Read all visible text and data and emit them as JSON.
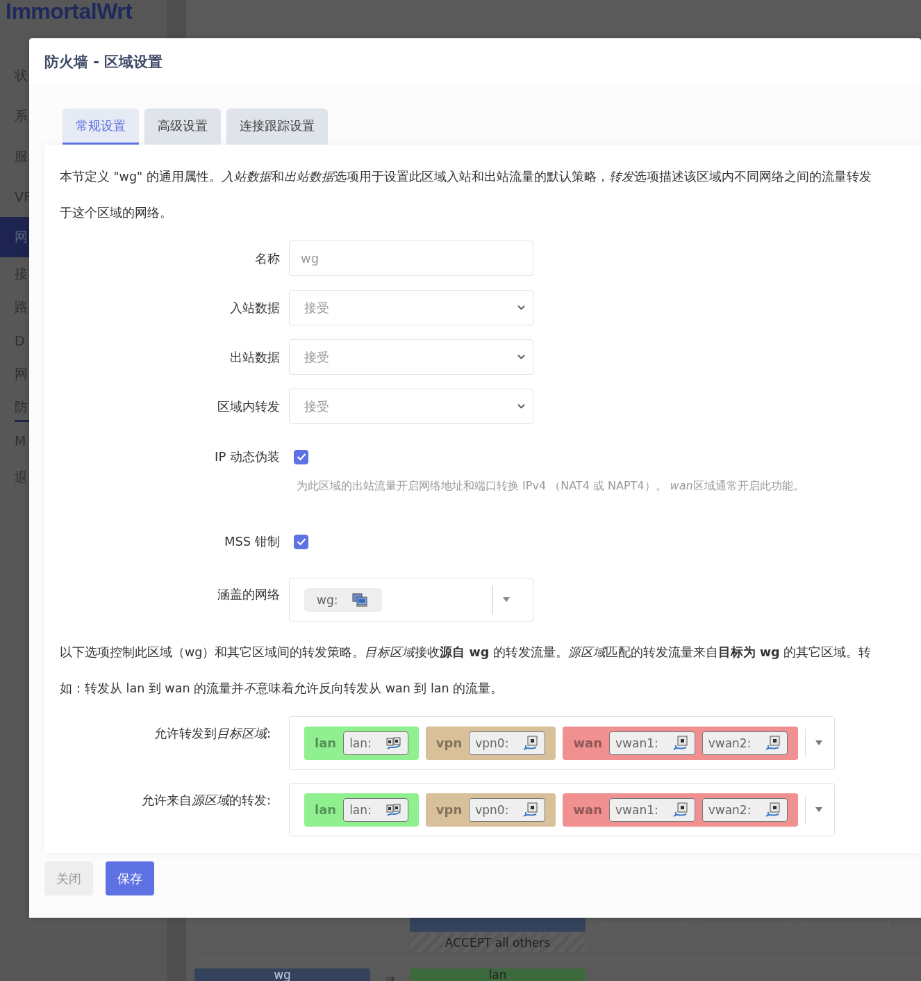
{
  "sidebar": {
    "logo": "ImmortalWrt",
    "items": [
      {
        "label": "状",
        "kind": "section",
        "selected": false
      },
      {
        "label": "系",
        "kind": "section",
        "selected": false
      },
      {
        "label": "服",
        "kind": "section",
        "selected": false
      },
      {
        "label": "VF",
        "kind": "section",
        "selected": false
      },
      {
        "label": "网",
        "kind": "section",
        "selected": true
      },
      {
        "label": "接",
        "kind": "subitem",
        "selected": false
      },
      {
        "label": "路",
        "kind": "subitem",
        "selected": false
      },
      {
        "label": "D",
        "kind": "subitem",
        "selected": false
      },
      {
        "label": "网",
        "kind": "subitem",
        "selected": false
      },
      {
        "label": "防",
        "kind": "subitem",
        "selected": true
      },
      {
        "label": "M",
        "kind": "subitem",
        "selected": false
      },
      {
        "label": "退",
        "kind": "section",
        "selected": false
      }
    ]
  },
  "background": {
    "policy": "ACCEPT all others",
    "rule": {
      "source": "wg",
      "arrow": "⇒",
      "destination": "lan"
    }
  },
  "dialog": {
    "title": "防火墙 - 区域设置",
    "tabs": [
      {
        "label": "常规设置",
        "selected": true
      },
      {
        "label": "高级设置",
        "selected": false
      },
      {
        "label": "连接跟踪设置",
        "selected": false
      }
    ],
    "intro_lines": [
      [
        {
          "text": "本节定义 \"wg\" 的通用属性。",
          "italic": false
        },
        {
          "text": "入站数据",
          "italic": true
        },
        {
          "text": "和",
          "italic": false
        },
        {
          "text": "出站数据",
          "italic": true
        },
        {
          "text": "选项用于设置此区域入站和出站流量的默认策略，",
          "italic": false
        },
        {
          "text": "转发",
          "italic": true
        },
        {
          "text": "选项描述该区域内不同网络之间的流量转发",
          "italic": false
        }
      ],
      [
        {
          "text": "于这个区域的网络。",
          "italic": false
        }
      ]
    ],
    "fields": [
      {
        "kind": "text",
        "label": "名称",
        "value": "wg"
      },
      {
        "kind": "select",
        "label": "入站数据",
        "value": "接受"
      },
      {
        "kind": "select",
        "label": "出站数据",
        "value": "接受"
      },
      {
        "kind": "select",
        "label": "区域内转发",
        "value": "接受"
      },
      {
        "kind": "checkbox",
        "label": "IP 动态伪装",
        "checked": true,
        "help": [
          {
            "text": "为此区域的出站流量开启网络地址和端口转换 IPv4 （NAT4 或 NAPT4）。 ",
            "italic": false
          },
          {
            "text": "wan",
            "italic": true
          },
          {
            "text": "区域通常开启此功能。",
            "italic": false
          }
        ]
      },
      {
        "kind": "checkbox",
        "label": "MSS 钳制",
        "checked": true
      },
      {
        "kind": "networks",
        "label": "涵盖的网络",
        "networks": [
          {
            "name": "wg:",
            "kind": "tunnel"
          }
        ]
      }
    ],
    "forward_intro_lines": [
      [
        {
          "text": "以下选项控制此区域（wg）和其它区域间的转发策略。",
          "italic": false
        },
        {
          "text": "目标区域",
          "italic": true
        },
        {
          "text": "接收**源自 wg** 的转发流量。",
          "italic": false
        },
        {
          "text": "源区域",
          "italic": true
        },
        {
          "text": "匹配的转发流量来自**目标为 wg** 的其它区域。转",
          "italic": false
        }
      ],
      [
        {
          "text": "如：转发从 lan 到 wan 的流量并",
          "italic": false
        },
        {
          "text": "不",
          "italic": true
        },
        {
          "text": "意味着允许反向转发从 wan 到 lan 的流量。",
          "italic": false
        }
      ]
    ],
    "forwardings": [
      {
        "label": [
          {
            "text": "允许转发到",
            "italic": false
          },
          {
            "text": "目标区域",
            "italic": true
          },
          {
            "text": ":",
            "italic": false
          }
        ],
        "zones": [
          {
            "name": "lan",
            "color": "#90f090",
            "networks": [
              {
                "name": "lan:",
                "kind": "bridge"
              }
            ]
          },
          {
            "name": "vpn",
            "color": "#d8c09a",
            "networks": [
              {
                "name": "vpn0:",
                "kind": "port"
              }
            ]
          },
          {
            "name": "wan",
            "color": "#f09090",
            "networks": [
              {
                "name": "vwan1:",
                "kind": "port"
              },
              {
                "name": "vwan2:",
                "kind": "port"
              }
            ]
          }
        ]
      },
      {
        "label": [
          {
            "text": "允许来自",
            "italic": false
          },
          {
            "text": "源区域",
            "italic": true
          },
          {
            "text": "的转发:",
            "italic": false
          }
        ],
        "zones": [
          {
            "name": "lan",
            "color": "#90f090",
            "networks": [
              {
                "name": "lan:",
                "kind": "bridge"
              }
            ]
          },
          {
            "name": "vpn",
            "color": "#d8c09a",
            "networks": [
              {
                "name": "vpn0:",
                "kind": "port"
              }
            ]
          },
          {
            "name": "wan",
            "color": "#f09090",
            "networks": [
              {
                "name": "vwan1:",
                "kind": "port"
              },
              {
                "name": "vwan2:",
                "kind": "port"
              }
            ]
          }
        ]
      }
    ],
    "buttons": [
      {
        "label": "关闭",
        "kind": "secondary"
      },
      {
        "label": "保存",
        "kind": "primary"
      }
    ]
  }
}
